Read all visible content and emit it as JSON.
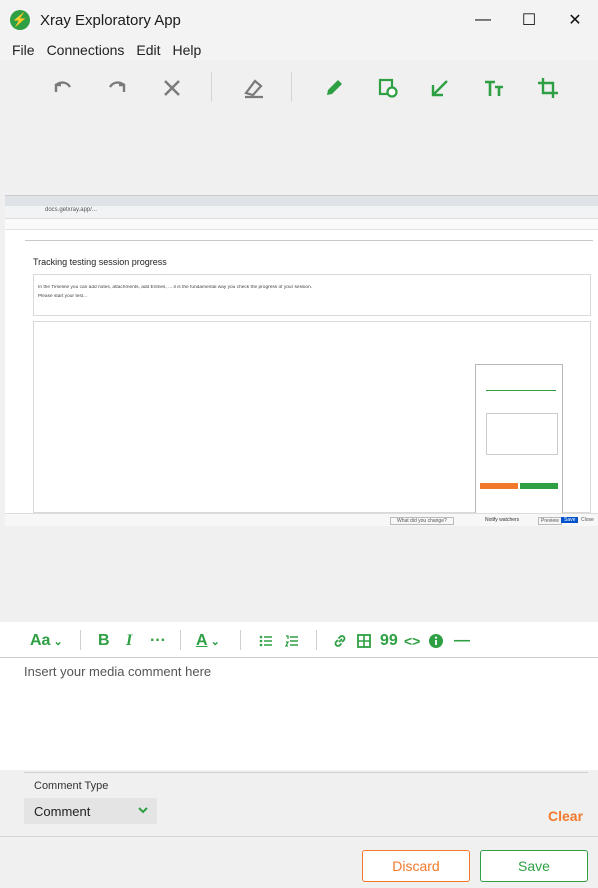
{
  "app": {
    "title": "Xray Exploratory App"
  },
  "window_controls": {
    "minimize": "—",
    "maximize": "☐",
    "close": "✕"
  },
  "menu": [
    "File",
    "Connections",
    "Edit",
    "Help"
  ],
  "toolbar": {
    "undo_icon": "undo-icon",
    "redo_icon": "redo-icon",
    "delete_icon": "close-icon",
    "eraser_icon": "eraser-icon",
    "pencil_icon": "pencil-icon",
    "shape_icon": "shape-icon",
    "arrow_icon": "arrow-icon",
    "text_icon": "text-icon",
    "crop_icon": "crop-icon"
  },
  "screenshot": {
    "page_title": "Tracking testing session progress",
    "para_line1": "In the Timeline you can add notes, attachments, add Entries, ... it is the fundamental way you check the progress of your session.",
    "para_line2": "Please start your test...",
    "url": "docs.getxray.app/...",
    "footer_input": "What did you change?",
    "footer_check": "Notify watchers",
    "footer_btn1": "Preview",
    "footer_btn2": "Save",
    "footer_btn3": "Close"
  },
  "editor_toolbar": {
    "text_style": "Aa",
    "bold": "B",
    "italic": "I",
    "more": "···",
    "color": "A",
    "quote": "99",
    "code": "<>",
    "hr": "—"
  },
  "editor": {
    "placeholder": "Insert your media comment here"
  },
  "comment_type": {
    "label": "Comment Type",
    "value": "Comment"
  },
  "actions": {
    "clear": "Clear",
    "discard": "Discard",
    "save": "Save"
  },
  "colors": {
    "accent": "#2ea043",
    "clear": "#f2792b",
    "discard_border": "#f2792b",
    "save_border": "#2ea043"
  }
}
